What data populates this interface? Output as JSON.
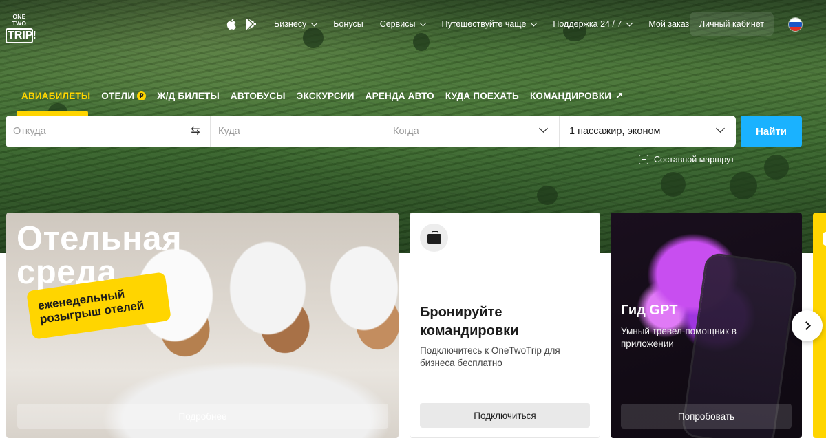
{
  "logo": {
    "line1": "ONE TWO",
    "line2": "TRIP!"
  },
  "topnav": {
    "store_icons": [
      "apple-icon",
      "google-play-icon"
    ],
    "items": [
      {
        "label": "Бизнесу",
        "has_dropdown": true
      },
      {
        "label": "Бонусы",
        "has_dropdown": false
      },
      {
        "label": "Сервисы",
        "has_dropdown": true
      },
      {
        "label": "Путешествуйте чаще",
        "has_dropdown": true
      },
      {
        "label": "Поддержка 24 / 7",
        "has_dropdown": true
      },
      {
        "label": "Мой заказ",
        "has_dropdown": false
      }
    ],
    "cabinet_label": "Личный кабинет",
    "language_flag": "russia-flag-icon"
  },
  "tabs": [
    {
      "label": "АВИАБИЛЕТЫ",
      "active": true
    },
    {
      "label": "ОТЕЛИ",
      "active": false,
      "icon": "bonus-coin-icon",
      "icon_glyph": "₽"
    },
    {
      "label": "Ж/Д БИЛЕТЫ",
      "active": false
    },
    {
      "label": "АВТОБУСЫ",
      "active": false
    },
    {
      "label": "ЭКСКУРСИИ",
      "active": false
    },
    {
      "label": "АРЕНДА АВТО",
      "active": false
    },
    {
      "label": "КУДА ПОЕХАТЬ",
      "active": false
    },
    {
      "label": "КОМАНДИРОВКИ",
      "active": false,
      "icon": "external-link-icon",
      "icon_glyph": "↗"
    }
  ],
  "search": {
    "from_placeholder": "Откуда",
    "to_placeholder": "Куда",
    "when_placeholder": "Когда",
    "passengers_value": "1 пассажир, эконом",
    "submit_label": "Найти",
    "multi_route_label": "Составной маршрут"
  },
  "cards": [
    {
      "title_line1": "Отельная",
      "title_line2": "среда",
      "sticker_line1": "еженедельный",
      "sticker_line2": "розыгрыш отелей",
      "button_label": "Подробнее"
    },
    {
      "icon": "briefcase-icon",
      "title": "Бронируйте командировки",
      "text": "Подключитесь к OneTwoTrip для бизнеса бесплатно",
      "button_label": "Подключиться"
    },
    {
      "title": "Гид GPT",
      "text": "Умный тревел-помощник в приложении",
      "button_label": "Попробовать"
    }
  ],
  "colors": {
    "accent_yellow": "#ffd500",
    "button_blue": "#1ab2ff",
    "text_dark": "#1c1c1c"
  }
}
